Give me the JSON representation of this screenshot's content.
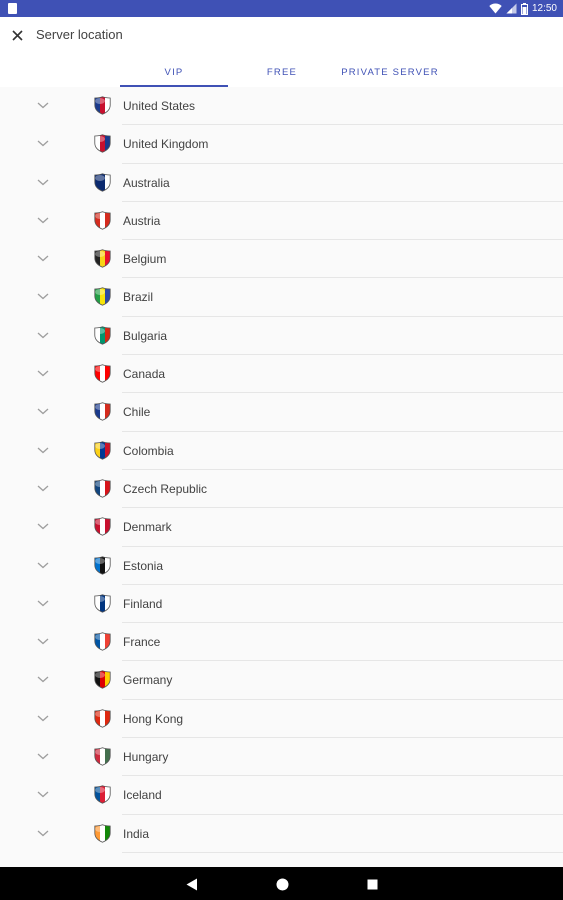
{
  "status_bar": {
    "time": "12:50"
  },
  "app_bar": {
    "title": "Server location",
    "close_icon": "close-icon"
  },
  "tabs": [
    {
      "label": "VIP",
      "active": true
    },
    {
      "label": "FREE",
      "active": false
    },
    {
      "label": "PRIVATE SERVER",
      "active": false
    }
  ],
  "countries": [
    {
      "name": "United States",
      "colors": [
        "#1a3a8c",
        "#c8102e",
        "#ffffff"
      ]
    },
    {
      "name": "United Kingdom",
      "colors": [
        "#ffffff",
        "#c8102e",
        "#1a3a8c"
      ]
    },
    {
      "name": "Australia",
      "colors": [
        "#0b2a6f",
        "#0b2a6f",
        "#ffffff"
      ]
    },
    {
      "name": "Austria",
      "colors": [
        "#d52b1e",
        "#ffffff",
        "#d52b1e"
      ]
    },
    {
      "name": "Belgium",
      "colors": [
        "#222222",
        "#f7d316",
        "#e8112d"
      ]
    },
    {
      "name": "Brazil",
      "colors": [
        "#229e45",
        "#f8e509",
        "#2b49a3"
      ]
    },
    {
      "name": "Bulgaria",
      "colors": [
        "#ffffff",
        "#00966e",
        "#d62612"
      ]
    },
    {
      "name": "Canada",
      "colors": [
        "#ff0000",
        "#ffffff",
        "#ff0000"
      ]
    },
    {
      "name": "Chile",
      "colors": [
        "#1a3a8c",
        "#ffffff",
        "#d52b1e"
      ]
    },
    {
      "name": "Colombia",
      "colors": [
        "#fcd116",
        "#003893",
        "#ce1126"
      ]
    },
    {
      "name": "Czech Republic",
      "colors": [
        "#11457e",
        "#ffffff",
        "#d7141a"
      ]
    },
    {
      "name": "Denmark",
      "colors": [
        "#c8102e",
        "#ffffff",
        "#c8102e"
      ]
    },
    {
      "name": "Estonia",
      "colors": [
        "#0072ce",
        "#111111",
        "#ffffff"
      ]
    },
    {
      "name": "Finland",
      "colors": [
        "#ffffff",
        "#003580",
        "#ffffff"
      ]
    },
    {
      "name": "France",
      "colors": [
        "#0055a4",
        "#ffffff",
        "#ef4135"
      ]
    },
    {
      "name": "Germany",
      "colors": [
        "#111111",
        "#dd0000",
        "#ffce00"
      ]
    },
    {
      "name": "Hong Kong",
      "colors": [
        "#de2910",
        "#ffffff",
        "#de2910"
      ]
    },
    {
      "name": "Hungary",
      "colors": [
        "#cd2a3e",
        "#ffffff",
        "#436f4d"
      ]
    },
    {
      "name": "Iceland",
      "colors": [
        "#02529c",
        "#dc1e35",
        "#ffffff"
      ]
    },
    {
      "name": "India",
      "colors": [
        "#ff9933",
        "#ffffff",
        "#138808"
      ]
    }
  ],
  "nav_bar": {
    "back_icon": "back-triangle-icon",
    "home_icon": "home-circle-icon",
    "recents_icon": "recents-square-icon"
  },
  "colors": {
    "primary": "#3f51b5",
    "text": "#424242",
    "divider": "#e6e6e6",
    "background": "#fafafa"
  }
}
